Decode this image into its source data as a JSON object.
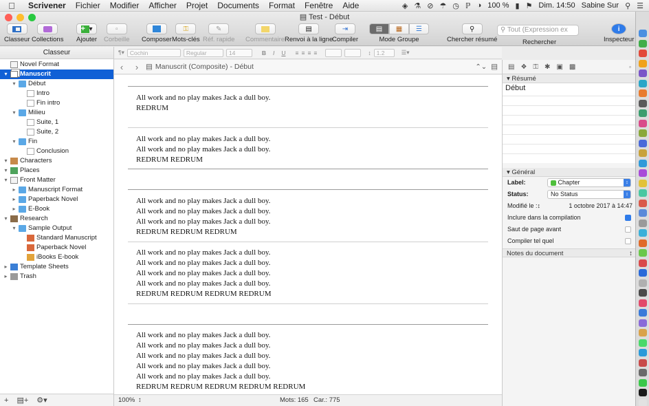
{
  "menubar": {
    "app": "Scrivener",
    "items": [
      "Fichier",
      "Modifier",
      "Afficher",
      "Projet",
      "Documents",
      "Format",
      "Fenêtre",
      "Aide"
    ],
    "battery": "100 %",
    "clock": "Dim. 14:50",
    "user": "Sabine Sur"
  },
  "window": {
    "title": "Test - Début"
  },
  "toolbar": {
    "binder": "Classeur",
    "collections": "Collections",
    "add": "Ajouter",
    "trash": "Corbeille",
    "compose": "Composer",
    "keywords": "Mots-clés",
    "quickref": "Réf. rapide",
    "comment": "Commentaire",
    "wrap": "Renvoi à la ligne",
    "compile": "Compiler",
    "group_mode": "Mode Groupe",
    "search_synopsis": "Chercher résumé",
    "search": "Rechercher",
    "search_placeholder": "Tout (Expression ex",
    "inspector": "Inspecteur"
  },
  "binder": {
    "header": "Classeur",
    "items": [
      {
        "label": "Novel Format",
        "level": 0,
        "kind": "page"
      },
      {
        "label": "Manuscrit",
        "level": 0,
        "kind": "stack",
        "selected": true,
        "expanded": true
      },
      {
        "label": "Début",
        "level": 1,
        "kind": "folder",
        "expanded": true
      },
      {
        "label": "Intro",
        "level": 2,
        "kind": "doc"
      },
      {
        "label": "Fin intro",
        "level": 2,
        "kind": "doc"
      },
      {
        "label": "Milieu",
        "level": 1,
        "kind": "folder",
        "expanded": true
      },
      {
        "label": "Suite, 1",
        "level": 2,
        "kind": "doc"
      },
      {
        "label": "Suite, 2",
        "level": 2,
        "kind": "doc"
      },
      {
        "label": "Fin",
        "level": 1,
        "kind": "folder",
        "expanded": true
      },
      {
        "label": "Conclusion",
        "level": 2,
        "kind": "doc"
      },
      {
        "label": "Characters",
        "level": 0,
        "kind": "chars",
        "expanded": true
      },
      {
        "label": "Places",
        "level": 0,
        "kind": "places",
        "expanded": true
      },
      {
        "label": "Front Matter",
        "level": 0,
        "kind": "page",
        "expanded": true
      },
      {
        "label": "Manuscript Format",
        "level": 1,
        "kind": "folder"
      },
      {
        "label": "Paperback Novel",
        "level": 1,
        "kind": "folder"
      },
      {
        "label": "E-Book",
        "level": 1,
        "kind": "folder"
      },
      {
        "label": "Research",
        "level": 0,
        "kind": "research",
        "expanded": true
      },
      {
        "label": "Sample Output",
        "level": 1,
        "kind": "folder",
        "expanded": true
      },
      {
        "label": "Standard Manuscript",
        "level": 2,
        "kind": "pdf"
      },
      {
        "label": "Paperback Novel",
        "level": 2,
        "kind": "pdf"
      },
      {
        "label": "iBooks E-book",
        "level": 2,
        "kind": "img"
      },
      {
        "label": "Template Sheets",
        "level": 0,
        "kind": "tmpl"
      },
      {
        "label": "Trash",
        "level": 0,
        "kind": "trash"
      }
    ]
  },
  "format_bar": {
    "font": "Cochin",
    "style": "Regular",
    "size": "14",
    "spacing": "1.2"
  },
  "editor": {
    "path": "Manuscrit (Composite) - Début",
    "sections": [
      {
        "lines": [
          "All work and no play makes Jack a dull boy.",
          "REDRUM"
        ]
      },
      {
        "lines": [
          "All work and no play makes Jack a dull boy.",
          "All work and no play makes Jack a dull boy.",
          "REDRUM REDRUM"
        ]
      },
      {
        "lines": [
          "All work and no play makes Jack a dull boy.",
          "All work and no play makes Jack a dull boy.",
          "All work and no play makes Jack a dull boy.",
          "REDRUM REDRUM REDRUM"
        ]
      },
      {
        "lines": [
          "All work and no play makes Jack a dull boy.",
          "All work and no play makes Jack a dull boy.",
          "All work and no play makes Jack a dull boy.",
          "All work and no play makes Jack a dull boy.",
          "REDRUM REDRUM REDRUM REDRUM"
        ]
      },
      {
        "lines": [
          "All work and no play makes Jack a dull boy.",
          "All work and no play makes Jack a dull boy.",
          "All work and no play makes Jack a dull boy.",
          "All work and no play makes Jack a dull boy.",
          "All work and no play makes Jack a dull boy.",
          "REDRUM REDRUM REDRUM REDRUM REDRUM"
        ]
      }
    ],
    "zoom": "100%",
    "words": "Mots: 165",
    "chars": "Car.: 775"
  },
  "inspector": {
    "synopsis_header": "Résumé",
    "synopsis_text": "Début",
    "general_header": "Général",
    "label_caption": "Label:",
    "label_value": "Chapter",
    "label_color": "#4fbf3c",
    "status_caption": "Status:",
    "status_value": "No Status",
    "modified_caption": "Modifié le :",
    "modified_value": "1 octobre 2017 à 14:47",
    "include_compile": "Inclure dans la compilation",
    "page_break": "Saut de page avant",
    "compile_as_is": "Compiler tel quel",
    "notes_header": "Notes du document"
  },
  "colors": {
    "selection": "#1060d6",
    "accent": "#2f7be9"
  }
}
